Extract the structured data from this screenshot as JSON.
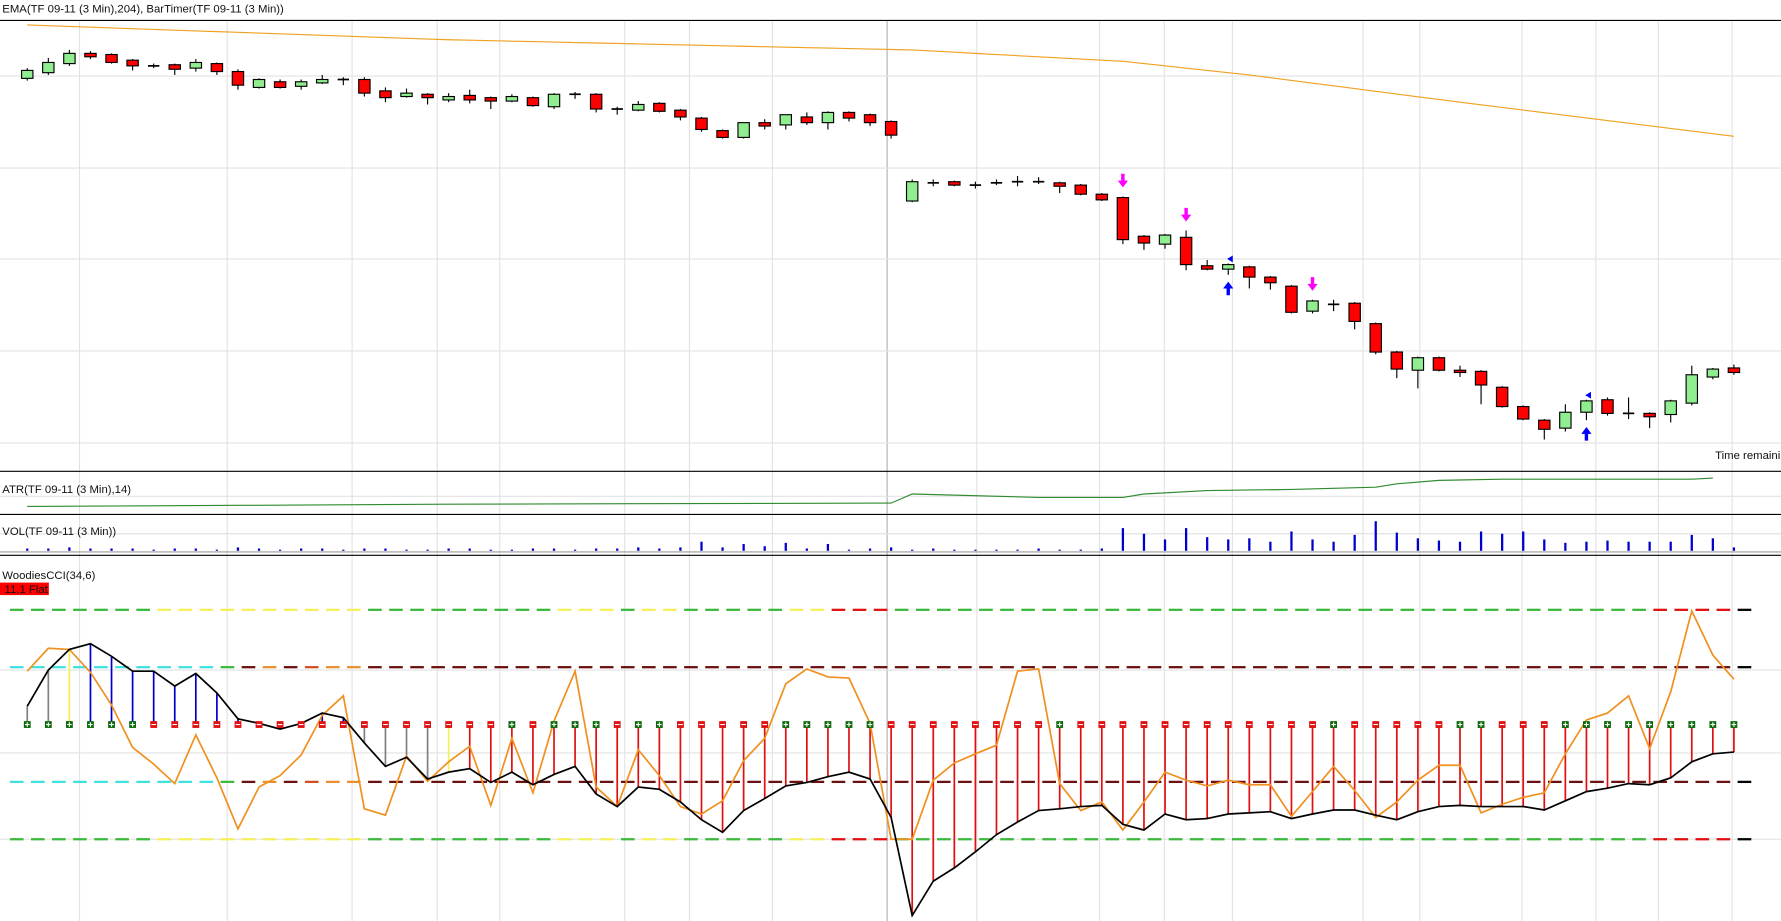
{
  "panels": {
    "price_label": "EMA(TF 09-11 (3 Min),204), BarTimer(TF 09-11 (3 Min))",
    "atr_label": "ATR(TF 09-11 (3 Min),14)",
    "vol_label": "VOL(TF 09-11 (3 Min))",
    "cci_label": "WoodiesCCI(34,6)",
    "cci_status": "11,1 Flat",
    "time_remaining": "Time remaini"
  },
  "colors": {
    "up": "#90ee90",
    "down": "#ff0000",
    "ema": "#f0a020",
    "atr": "#2e8b2e",
    "volume": "#0000cc",
    "cci": "#000000",
    "tcci": "#f09020",
    "status_bg": "#ff0000",
    "signal_down": "#ff00ff",
    "signal_up": "#0000ff",
    "green": "#3cb93c",
    "yellow": "#f5f05a",
    "red": "#e01010",
    "darkred": "#6b1010",
    "cyan": "#40e0e0",
    "orange": "#e89030",
    "orangered": "#d05020",
    "gray": "#808080",
    "blue": "#0000cc"
  },
  "chart_data": [
    {
      "type": "candlestick",
      "title": "EMA(TF 09-11 (3 Min),204), BarTimer(TF 09-11 (3 Min))",
      "note": "price units relative (no price axis visible)",
      "ylim": [
        -10,
        382
      ],
      "ohlc": [
        [
          331,
          340,
          329,
          338
        ],
        [
          336,
          349,
          334,
          345
        ],
        [
          344,
          356,
          342,
          353
        ],
        [
          353,
          355,
          348,
          350
        ],
        [
          352,
          353,
          344,
          345
        ],
        [
          347,
          348,
          338,
          342
        ],
        [
          342,
          344,
          340,
          342
        ],
        [
          343,
          344,
          334,
          339
        ],
        [
          340,
          348,
          337,
          345
        ],
        [
          344,
          345,
          334,
          337
        ],
        [
          337,
          339,
          321,
          325
        ],
        [
          323,
          331,
          322,
          330
        ],
        [
          328,
          330,
          322,
          323
        ],
        [
          324,
          330,
          321,
          328
        ],
        [
          327,
          334,
          326,
          330
        ],
        [
          330,
          332,
          325,
          330
        ],
        [
          330,
          332,
          315,
          318
        ],
        [
          320,
          323,
          310,
          314
        ],
        [
          315,
          322,
          314,
          318
        ],
        [
          317,
          318,
          308,
          314
        ],
        [
          312,
          318,
          310,
          315
        ],
        [
          316,
          321,
          309,
          312
        ],
        [
          314,
          315,
          304,
          311
        ],
        [
          311,
          317,
          310,
          315
        ],
        [
          314,
          315,
          306,
          307
        ],
        [
          306,
          318,
          304,
          317
        ],
        [
          317,
          319,
          313,
          317
        ],
        [
          317,
          318,
          301,
          304
        ],
        [
          304,
          306,
          299,
          304
        ],
        [
          303,
          311,
          302,
          308
        ],
        [
          309,
          310,
          301,
          302
        ],
        [
          303,
          304,
          294,
          297
        ],
        [
          296,
          297,
          284,
          286
        ],
        [
          285,
          286,
          278,
          279
        ],
        [
          279,
          292,
          278,
          292
        ],
        [
          292,
          295,
          286,
          289
        ],
        [
          290,
          299,
          286,
          299
        ],
        [
          297,
          301,
          290,
          292
        ],
        [
          292,
          302,
          286,
          301
        ],
        [
          301,
          302,
          293,
          296
        ],
        [
          299,
          300,
          289,
          292
        ],
        [
          293,
          294,
          278,
          281
        ],
        [
          223,
          242,
          222,
          240
        ],
        [
          239,
          242,
          236,
          239
        ],
        [
          240,
          241,
          236,
          237
        ],
        [
          237,
          240,
          234,
          237
        ],
        [
          239,
          242,
          237,
          239
        ],
        [
          240,
          245,
          236,
          240
        ],
        [
          240,
          244,
          238,
          240
        ],
        [
          239,
          240,
          230,
          236
        ],
        [
          237,
          238,
          228,
          229
        ],
        [
          229,
          230,
          223,
          224
        ],
        [
          226,
          227,
          185,
          189
        ],
        [
          192,
          193,
          180,
          186
        ],
        [
          185,
          194,
          181,
          193
        ],
        [
          191,
          197,
          162,
          167
        ],
        [
          166,
          171,
          162,
          163
        ],
        [
          163,
          168,
          158,
          167
        ],
        [
          165,
          166,
          146,
          156
        ],
        [
          156,
          157,
          145,
          151
        ],
        [
          148,
          149,
          124,
          125
        ],
        [
          126,
          136,
          124,
          135
        ],
        [
          132,
          136,
          126,
          132
        ],
        [
          133,
          134,
          110,
          117
        ],
        [
          115,
          116,
          88,
          90
        ],
        [
          90,
          91,
          67,
          75
        ],
        [
          74,
          86,
          58,
          85
        ],
        [
          85,
          86,
          73,
          74
        ],
        [
          74,
          78,
          68,
          72
        ],
        [
          73,
          74,
          44,
          61
        ],
        [
          59,
          60,
          41,
          42
        ],
        [
          42,
          43,
          30,
          31
        ],
        [
          30,
          31,
          13,
          22
        ],
        [
          23,
          44,
          20,
          37
        ],
        [
          37,
          48,
          30,
          47
        ],
        [
          48,
          50,
          34,
          36
        ],
        [
          36,
          50,
          31,
          36
        ],
        [
          36,
          37,
          23,
          33
        ],
        [
          35,
          48,
          28,
          47
        ],
        [
          45,
          78,
          43,
          70
        ],
        [
          68,
          76,
          66,
          75
        ],
        [
          76,
          79,
          70,
          72
        ]
      ],
      "ema_points": [
        [
          0,
          378
        ],
        [
          20,
          365
        ],
        [
          42,
          356
        ],
        [
          52,
          346
        ],
        [
          58,
          334
        ],
        [
          68,
          310
        ],
        [
          81,
          280
        ]
      ],
      "session_break_after": 41,
      "signals_down": [
        52,
        55,
        61
      ],
      "signals_up": [
        57,
        74
      ]
    },
    {
      "type": "line",
      "title": "ATR(TF 09-11 (3 Min),14)",
      "ylim": [
        0,
        32
      ],
      "points": [
        [
          0,
          4
        ],
        [
          10,
          5
        ],
        [
          20,
          6
        ],
        [
          41,
          7
        ],
        [
          42,
          15
        ],
        [
          48,
          12
        ],
        [
          52,
          12
        ],
        [
          53,
          15
        ],
        [
          56,
          18
        ],
        [
          60,
          19
        ],
        [
          64,
          21
        ],
        [
          65,
          24
        ],
        [
          67,
          27
        ],
        [
          70,
          28
        ],
        [
          79,
          28
        ],
        [
          80,
          29
        ]
      ]
    },
    {
      "type": "bar",
      "title": "VOL(TF 09-11 (3 Min))",
      "ylim": [
        0,
        28
      ],
      "values": [
        2,
        2,
        3,
        2,
        2,
        2,
        1,
        2,
        2,
        1,
        3,
        2,
        1,
        2,
        2,
        1,
        2,
        2,
        1,
        1,
        2,
        2,
        1,
        1,
        2,
        2,
        1,
        2,
        2,
        3,
        2,
        3,
        8,
        3,
        6,
        4,
        7,
        2,
        6,
        1,
        2,
        3,
        1,
        2,
        1,
        1,
        1,
        1,
        2,
        1,
        1,
        2,
        20,
        15,
        10,
        20,
        12,
        10,
        11,
        8,
        17,
        10,
        8,
        14,
        26,
        16,
        11,
        9,
        8,
        17,
        15,
        17,
        10,
        7,
        8,
        9,
        8,
        8,
        8,
        14,
        11,
        3
      ]
    },
    {
      "type": "line",
      "title": "WoodiesCCI(34,6)",
      "ylim": [
        -330,
        200
      ],
      "levels": [
        200,
        100,
        0,
        -100,
        -200
      ],
      "series": [
        {
          "name": "CCI",
          "values": [
            32,
            95,
            131,
            141,
            119,
            93,
            93,
            67,
            89,
            55,
            10,
            2,
            -8,
            2,
            20,
            12,
            -32,
            -73,
            -57,
            -95,
            -83,
            -77,
            -101,
            -83,
            -105,
            -87,
            -73,
            -121,
            -143,
            -109,
            -113,
            -135,
            -166,
            -188,
            -150,
            -129,
            -107,
            -101,
            -91,
            -83,
            -95,
            -162,
            -333,
            -273,
            -250,
            -222,
            -192,
            -170,
            -150,
            -147,
            -143,
            -141,
            -174,
            -184,
            -156,
            -166,
            -164,
            -156,
            -154,
            -152,
            -164,
            -156,
            -149,
            -149,
            -158,
            -166,
            -152,
            -143,
            -141,
            -143,
            -143,
            -143,
            -149,
            -133,
            -117,
            -111,
            -103,
            -105,
            -93,
            -65,
            -51,
            -48
          ]
        },
        {
          "name": "TurboCCI",
          "values": [
            93,
            133,
            131,
            91,
            34,
            -40,
            -69,
            -103,
            -18,
            -93,
            -182,
            -109,
            -89,
            -53,
            16,
            50,
            -147,
            -158,
            -55,
            -99,
            -65,
            -38,
            -141,
            -24,
            -119,
            6,
            93,
            -109,
            -143,
            -44,
            -89,
            -143,
            -156,
            -133,
            -63,
            -24,
            71,
            97,
            83,
            81,
            2,
            -200,
            -200,
            -97,
            -67,
            -51,
            -36,
            93,
            97,
            -103,
            -150,
            -135,
            -184,
            -135,
            -83,
            -97,
            -107,
            -97,
            -105,
            -105,
            -160,
            -117,
            -73,
            -115,
            -162,
            -135,
            -97,
            -71,
            -71,
            -154,
            -139,
            -127,
            -119,
            -51,
            8,
            20,
            50,
            -42,
            57,
            198,
            121,
            79
          ]
        }
      ],
      "histogram_colors": [
        [
          0,
          1,
          "gray"
        ],
        [
          2,
          2,
          "yellow"
        ],
        [
          3,
          15,
          "blue"
        ],
        [
          16,
          19,
          "gray"
        ],
        [
          20,
          20,
          "yellow"
        ],
        [
          21,
          81,
          "red"
        ]
      ],
      "zero_markers_plus": [
        0,
        1,
        2,
        3,
        4,
        5,
        23,
        25,
        26,
        27,
        29,
        30,
        36,
        37,
        38,
        39,
        40,
        49,
        62,
        68,
        69,
        73,
        74,
        75,
        76,
        77,
        78,
        79,
        80,
        81
      ],
      "band200_colors": [
        [
          0,
          6,
          "green"
        ],
        [
          7,
          16,
          "yellow"
        ],
        [
          17,
          25,
          "green"
        ],
        [
          26,
          28,
          "yellow"
        ],
        [
          29,
          29,
          "green"
        ],
        [
          30,
          31,
          "yellow"
        ],
        [
          32,
          36,
          "green"
        ],
        [
          37,
          38,
          "yellow"
        ],
        [
          39,
          41,
          "red"
        ],
        [
          42,
          77,
          "green"
        ],
        [
          78,
          81,
          "red"
        ]
      ],
      "band100_colors": [
        [
          0,
          9,
          "cyan"
        ],
        [
          10,
          10,
          "green"
        ],
        [
          11,
          11,
          "darkred"
        ],
        [
          12,
          12,
          "orange"
        ],
        [
          13,
          13,
          "darkred"
        ],
        [
          14,
          14,
          "orangered"
        ],
        [
          15,
          16,
          "orange"
        ],
        [
          17,
          81,
          "darkred"
        ]
      ]
    }
  ]
}
